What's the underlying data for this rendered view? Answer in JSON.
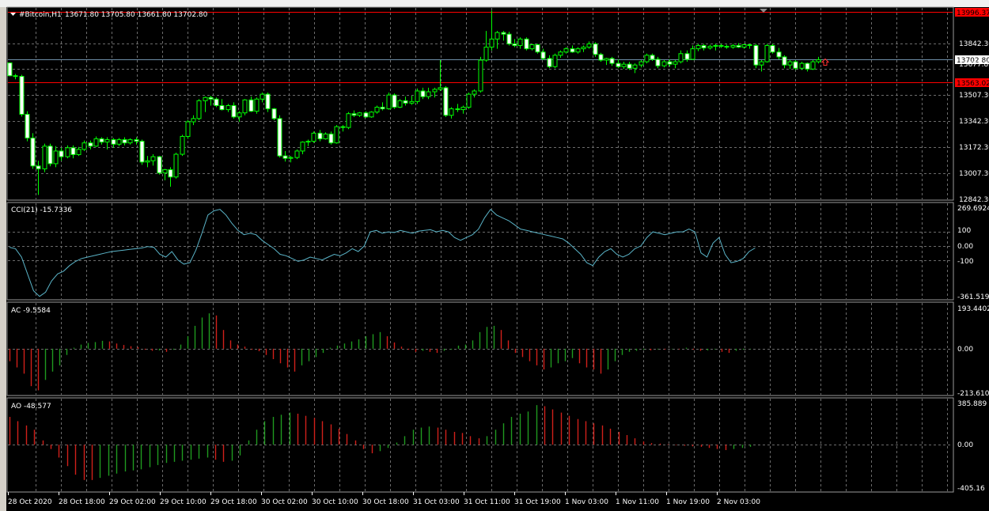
{
  "window": {
    "title": "#Bitcoin,H1",
    "ohlc": "13671.80 13705.80 13661.80 13702.80"
  },
  "colors": {
    "background": "#000000",
    "grid": "#6b6b6b",
    "bull": "#00ff00",
    "bear": "#ff0000",
    "cci": "#5ab4c8",
    "ac_up": "#1f9a1f",
    "ac_down": "#d0201a",
    "level_line": "#ff0000",
    "bid_line": "#6f8fa8"
  },
  "chart_data": [
    {
      "type": "candlestick",
      "title": "#Bitcoin,H1",
      "ylim": [
        12842.3,
        14012.0
      ],
      "y_ticks": [
        "13842.30",
        "13507.30",
        "13342.30",
        "13172.30",
        "13007.30",
        "12842.30"
      ],
      "price_tags": {
        "current": "13702.80",
        "near": "13677.80",
        "upper_level": "13996.37",
        "lower_level": "13563.02"
      },
      "levels": [
        13996.37,
        13563.02
      ],
      "current_price": 13702.8,
      "arrow_marker": 13688.0,
      "candles": [
        [
          13683,
          13683,
          13601,
          13604
        ],
        [
          13604,
          13615,
          13582,
          13600
        ],
        [
          13600,
          13610,
          13352,
          13366
        ],
        [
          13366,
          13385,
          13200,
          13220
        ],
        [
          13220,
          13250,
          13030,
          13048
        ],
        [
          13048,
          13080,
          12870,
          13030
        ],
        [
          13030,
          13185,
          13010,
          13170
        ],
        [
          13170,
          13185,
          13046,
          13062
        ],
        [
          13062,
          13170,
          13040,
          13140
        ],
        [
          13140,
          13160,
          13080,
          13105
        ],
        [
          13105,
          13175,
          13095,
          13160
        ],
        [
          13160,
          13175,
          13095,
          13118
        ],
        [
          13118,
          13165,
          13110,
          13150
        ],
        [
          13150,
          13205,
          13140,
          13190
        ],
        [
          13190,
          13205,
          13150,
          13170
        ],
        [
          13170,
          13230,
          13165,
          13215
        ],
        [
          13215,
          13225,
          13180,
          13195
        ],
        [
          13195,
          13225,
          13150,
          13210
        ],
        [
          13210,
          13220,
          13160,
          13182
        ],
        [
          13182,
          13220,
          13170,
          13210
        ],
        [
          13210,
          13225,
          13175,
          13190
        ],
        [
          13190,
          13218,
          13180,
          13210
        ],
        [
          13210,
          13225,
          13180,
          13200
        ],
        [
          13200,
          13210,
          13055,
          13072
        ],
        [
          13072,
          13110,
          13040,
          13080
        ],
        [
          13080,
          13120,
          13050,
          13105
        ],
        [
          13105,
          13110,
          12995,
          13005
        ],
        [
          13005,
          13030,
          12960,
          13025
        ],
        [
          13025,
          13040,
          12920,
          12980
        ],
        [
          12980,
          13130,
          12970,
          13120
        ],
        [
          13120,
          13240,
          13110,
          13230
        ],
        [
          13230,
          13330,
          13215,
          13320
        ],
        [
          13320,
          13360,
          13300,
          13340
        ],
        [
          13340,
          13460,
          13330,
          13450
        ],
        [
          13450,
          13475,
          13380,
          13470
        ],
        [
          13470,
          13480,
          13420,
          13460
        ],
        [
          13460,
          13470,
          13410,
          13420
        ],
        [
          13420,
          13460,
          13390,
          13395
        ],
        [
          13395,
          13430,
          13380,
          13420
        ],
        [
          13420,
          13440,
          13340,
          13350
        ],
        [
          13350,
          13385,
          13320,
          13375
        ],
        [
          13375,
          13460,
          13360,
          13455
        ],
        [
          13455,
          13475,
          13380,
          13385
        ],
        [
          13385,
          13470,
          13370,
          13460
        ],
        [
          13460,
          13500,
          13440,
          13490
        ],
        [
          13490,
          13500,
          13380,
          13400
        ],
        [
          13400,
          13405,
          13330,
          13340
        ],
        [
          13340,
          13360,
          13100,
          13110
        ],
        [
          13110,
          13140,
          13075,
          13095
        ],
        [
          13095,
          13110,
          13070,
          13100
        ],
        [
          13100,
          13150,
          13090,
          13140
        ],
        [
          13140,
          13200,
          13120,
          13195
        ],
        [
          13195,
          13210,
          13170,
          13200
        ],
        [
          13200,
          13260,
          13190,
          13250
        ],
        [
          13250,
          13270,
          13200,
          13215
        ],
        [
          13215,
          13255,
          13210,
          13245
        ],
        [
          13245,
          13260,
          13180,
          13190
        ],
        [
          13190,
          13300,
          13185,
          13290
        ],
        [
          13290,
          13300,
          13260,
          13285
        ],
        [
          13285,
          13380,
          13275,
          13370
        ],
        [
          13370,
          13390,
          13350,
          13360
        ],
        [
          13360,
          13380,
          13350,
          13375
        ],
        [
          13375,
          13385,
          13345,
          13350
        ],
        [
          13350,
          13385,
          13345,
          13380
        ],
        [
          13380,
          13420,
          13370,
          13410
        ],
        [
          13410,
          13440,
          13390,
          13400
        ],
        [
          13400,
          13500,
          13395,
          13485
        ],
        [
          13485,
          13495,
          13400,
          13410
        ],
        [
          13410,
          13460,
          13405,
          13450
        ],
        [
          13450,
          13475,
          13420,
          13435
        ],
        [
          13435,
          13480,
          13425,
          13445
        ],
        [
          13445,
          13525,
          13430,
          13510
        ],
        [
          13510,
          13530,
          13460,
          13475
        ],
        [
          13475,
          13530,
          13460,
          13505
        ],
        [
          13505,
          13530,
          13470,
          13520
        ],
        [
          13520,
          13700,
          13510,
          13530
        ],
        [
          13530,
          13540,
          13350,
          13360
        ],
        [
          13360,
          13410,
          13340,
          13400
        ],
        [
          13400,
          13430,
          13380,
          13395
        ],
        [
          13395,
          13420,
          13370,
          13410
        ],
        [
          13410,
          13500,
          13400,
          13490
        ],
        [
          13490,
          13520,
          13470,
          13510
        ],
        [
          13510,
          13720,
          13500,
          13700
        ],
        [
          13700,
          13880,
          13690,
          13780
        ],
        [
          13780,
          14005,
          13760,
          13830
        ],
        [
          13830,
          13880,
          13770,
          13870
        ],
        [
          13870,
          13880,
          13820,
          13860
        ],
        [
          13860,
          13875,
          13790,
          13800
        ],
        [
          13800,
          13830,
          13780,
          13790
        ],
        [
          13790,
          13840,
          13770,
          13830
        ],
        [
          13830,
          13840,
          13760,
          13770
        ],
        [
          13770,
          13800,
          13760,
          13795
        ],
        [
          13795,
          13800,
          13740,
          13750
        ],
        [
          13750,
          13770,
          13700,
          13710
        ],
        [
          13710,
          13730,
          13650,
          13660
        ],
        [
          13660,
          13740,
          13650,
          13730
        ],
        [
          13730,
          13760,
          13715,
          13750
        ],
        [
          13750,
          13780,
          13740,
          13770
        ],
        [
          13770,
          13790,
          13745,
          13750
        ],
        [
          13750,
          13780,
          13740,
          13770
        ],
        [
          13770,
          13790,
          13750,
          13780
        ],
        [
          13780,
          13815,
          13770,
          13800
        ],
        [
          13800,
          13810,
          13720,
          13735
        ],
        [
          13735,
          13745,
          13690,
          13700
        ],
        [
          13700,
          13715,
          13670,
          13710
        ],
        [
          13710,
          13720,
          13665,
          13680
        ],
        [
          13680,
          13705,
          13650,
          13660
        ],
        [
          13660,
          13690,
          13645,
          13675
        ],
        [
          13675,
          13690,
          13640,
          13650
        ],
        [
          13650,
          13680,
          13620,
          13670
        ],
        [
          13670,
          13700,
          13655,
          13690
        ],
        [
          13690,
          13740,
          13680,
          13730
        ],
        [
          13730,
          13740,
          13695,
          13705
        ],
        [
          13705,
          13720,
          13650,
          13665
        ],
        [
          13665,
          13700,
          13655,
          13690
        ],
        [
          13690,
          13705,
          13660,
          13675
        ],
        [
          13675,
          13700,
          13650,
          13690
        ],
        [
          13690,
          13760,
          13680,
          13740
        ],
        [
          13740,
          13760,
          13690,
          13705
        ],
        [
          13705,
          13790,
          13700,
          13770
        ],
        [
          13770,
          13800,
          13755,
          13790
        ],
        [
          13790,
          13800,
          13760,
          13775
        ],
        [
          13775,
          13795,
          13765,
          13785
        ],
        [
          13785,
          13800,
          13760,
          13790
        ],
        [
          13790,
          13800,
          13775,
          13785
        ],
        [
          13785,
          13795,
          13770,
          13780
        ],
        [
          13780,
          13800,
          13770,
          13790
        ],
        [
          13790,
          13805,
          13775,
          13780
        ],
        [
          13780,
          13800,
          13770,
          13795
        ],
        [
          13795,
          13800,
          13770,
          13790
        ],
        [
          13790,
          13800,
          13650,
          13670
        ],
        [
          13670,
          13700,
          13630,
          13690
        ],
        [
          13690,
          13800,
          13685,
          13790
        ],
        [
          13790,
          13800,
          13740,
          13750
        ],
        [
          13750,
          13775,
          13705,
          13720
        ],
        [
          13720,
          13730,
          13650,
          13670
        ],
        [
          13670,
          13700,
          13645,
          13690
        ],
        [
          13690,
          13700,
          13640,
          13650
        ],
        [
          13650,
          13690,
          13640,
          13680
        ],
        [
          13680,
          13685,
          13630,
          13645
        ],
        [
          13645,
          13700,
          13640,
          13690
        ],
        [
          13690,
          13720,
          13680,
          13703
        ]
      ]
    },
    {
      "type": "line",
      "title": "CCI(21) -15.7336",
      "ylim": [
        -361.519,
        269.6924
      ],
      "y_ticks": [
        "269.6924",
        "100",
        "0.00",
        "-100",
        "-361.519"
      ],
      "levels": [
        100,
        0,
        -100
      ],
      "values": [
        -10,
        -20,
        -80,
        -200,
        -320,
        -360,
        -330,
        -250,
        -200,
        -180,
        -140,
        -110,
        -90,
        -80,
        -70,
        -60,
        -50,
        -40,
        -35,
        -30,
        -25,
        -20,
        -15,
        -5,
        -10,
        -60,
        -80,
        -40,
        -100,
        -130,
        -120,
        -30,
        90,
        220,
        250,
        260,
        220,
        160,
        110,
        80,
        90,
        80,
        40,
        10,
        -20,
        -60,
        -70,
        -90,
        -110,
        -100,
        -80,
        -90,
        -100,
        -80,
        -60,
        -70,
        -50,
        -20,
        -40,
        0,
        100,
        110,
        90,
        100,
        95,
        110,
        100,
        90,
        105,
        110,
        115,
        100,
        110,
        100,
        60,
        40,
        60,
        80,
        120,
        200,
        260,
        220,
        200,
        180,
        150,
        120,
        110,
        100,
        90,
        80,
        70,
        60,
        50,
        20,
        -20,
        -60,
        -120,
        -140,
        -80,
        -40,
        -20,
        -60,
        -80,
        -60,
        -20,
        0,
        60,
        100,
        90,
        80,
        90,
        100,
        100,
        120,
        100,
        -50,
        -80,
        20,
        60,
        -60,
        -120,
        -110,
        -90,
        -40,
        -15
      ]
    },
    {
      "type": "bar",
      "title": "AC -9.5584",
      "ylim": [
        -213.6103,
        193.4402
      ],
      "y_ticks": [
        "193.4402",
        "0.00",
        "-213.6103"
      ],
      "values": [
        -60,
        -90,
        -120,
        -180,
        -200,
        -150,
        -110,
        -80,
        -30,
        5,
        20,
        28,
        32,
        38,
        35,
        25,
        18,
        12,
        8,
        -5,
        -10,
        -8,
        -15,
        -5,
        20,
        60,
        110,
        150,
        170,
        160,
        90,
        40,
        20,
        10,
        -5,
        -12,
        -30,
        -50,
        -70,
        -90,
        -110,
        -80,
        -60,
        -40,
        -20,
        5,
        15,
        25,
        35,
        45,
        60,
        70,
        80,
        60,
        30,
        10,
        -5,
        -15,
        -10,
        -15,
        -20,
        -10,
        -5,
        15,
        20,
        40,
        80,
        105,
        110,
        90,
        40,
        -20,
        -40,
        -60,
        -80,
        -100,
        -90,
        -70,
        -60,
        -45,
        -70,
        -90,
        -100,
        -120,
        -100,
        -60,
        -30,
        -15,
        -10,
        -5,
        -8,
        -3,
        -4,
        -2,
        -3,
        5,
        -5,
        -10,
        -8,
        -3,
        -15,
        -20,
        -10,
        -5,
        -2
      ]
    },
    {
      "type": "bar",
      "title": "AO -48.577",
      "ylim": [
        -405.16,
        385.889
      ],
      "y_ticks": [
        "385.889",
        "0.00",
        "-405.16"
      ],
      "values": [
        260,
        220,
        180,
        140,
        40,
        -40,
        -120,
        -200,
        -280,
        -330,
        -330,
        -310,
        -290,
        -270,
        -250,
        -240,
        -230,
        -210,
        -190,
        -170,
        -160,
        -150,
        -140,
        -130,
        -120,
        -140,
        -160,
        -150,
        -100,
        40,
        140,
        220,
        260,
        280,
        300,
        290,
        270,
        250,
        220,
        190,
        150,
        100,
        40,
        -40,
        -80,
        -60,
        -30,
        20,
        80,
        140,
        160,
        170,
        160,
        140,
        120,
        110,
        80,
        60,
        80,
        140,
        200,
        260,
        290,
        310,
        370,
        360,
        330,
        300,
        270,
        240,
        220,
        200,
        180,
        150,
        120,
        90,
        60,
        30,
        15,
        10,
        5,
        -5,
        -10,
        -15,
        -20,
        -30,
        -40,
        -50,
        -40,
        -30,
        -20
      ]
    }
  ],
  "x_labels": [
    "28 Oct 2020",
    "28 Oct 18:00",
    "29 Oct 02:00",
    "29 Oct 10:00",
    "29 Oct 18:00",
    "30 Oct 02:00",
    "30 Oct 10:00",
    "30 Oct 18:00",
    "31 Oct 03:00",
    "31 Oct 11:00",
    "31 Oct 19:00",
    "1 Nov 03:00",
    "1 Nov 11:00",
    "1 Nov 19:00",
    "2 Nov 03:00"
  ]
}
